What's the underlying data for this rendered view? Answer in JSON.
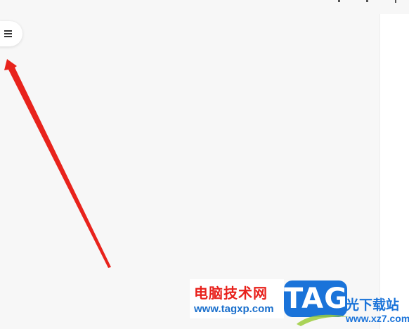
{
  "sidebar": {
    "menu_icon": "hamburger-menu-icon"
  },
  "annotation": {
    "arrow_color": "#e8231c"
  },
  "watermark": {
    "title": "电脑技术网",
    "url": "www.tagxp.com",
    "tag": "TAG",
    "right_text": "光下载站",
    "right_url": "www.xz7.com"
  },
  "colors": {
    "background": "#f7f7f7",
    "panel": "#ffffff",
    "watermark_red": "#e8211c",
    "watermark_blue": "#1a73d9"
  }
}
